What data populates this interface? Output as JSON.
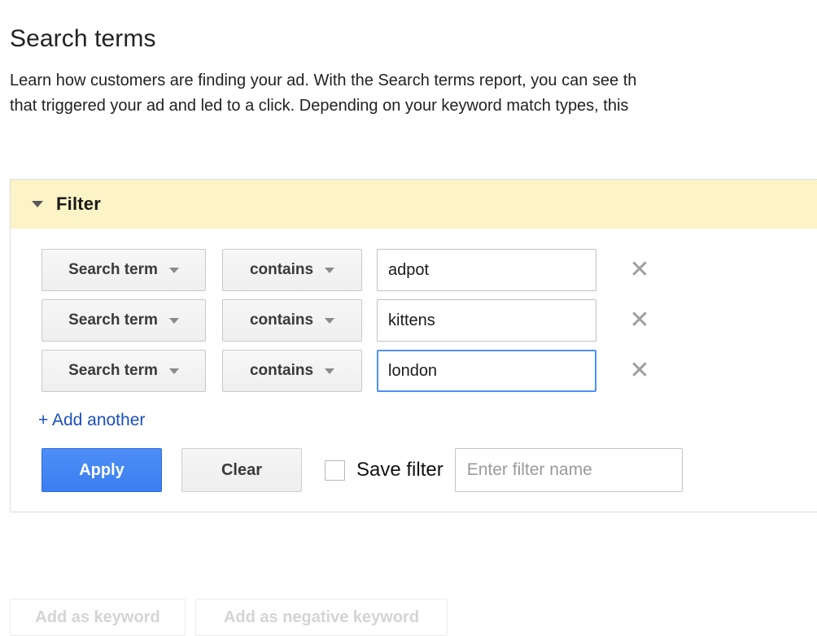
{
  "page": {
    "title": "Search terms",
    "description_line1": "Learn how customers are finding your ad. With the Search terms report, you can see th",
    "description_line2": "that triggered your ad and led to a click. Depending on your keyword match types, this"
  },
  "filter_panel": {
    "header_label": "Filter",
    "disclosure_icon": "caret-down-icon",
    "header_bg": "#fcf4c6",
    "rows": [
      {
        "field": "Search term",
        "operator": "contains",
        "value": "adpot",
        "value_focused": false,
        "remove_icon": "close-x-icon"
      },
      {
        "field": "Search term",
        "operator": "contains",
        "value": "kittens",
        "value_focused": false,
        "remove_icon": "close-x-icon"
      },
      {
        "field": "Search term",
        "operator": "contains",
        "value": "london",
        "value_focused": true,
        "remove_icon": "close-x-icon"
      }
    ],
    "add_another_label": "+ Add another",
    "add_another_color": "#1a4fbd",
    "actions": {
      "apply_label": "Apply",
      "apply_color": "#3b7ef0",
      "clear_label": "Clear",
      "save_filter_label": "Save filter",
      "save_filter_checked": false,
      "filter_name_value": "",
      "filter_name_placeholder": "Enter filter name"
    }
  },
  "bottom_toolbar": {
    "add_as_keyword_label": "Add as keyword",
    "add_as_negative_keyword_label": "Add as negative keyword",
    "disabled": true
  }
}
